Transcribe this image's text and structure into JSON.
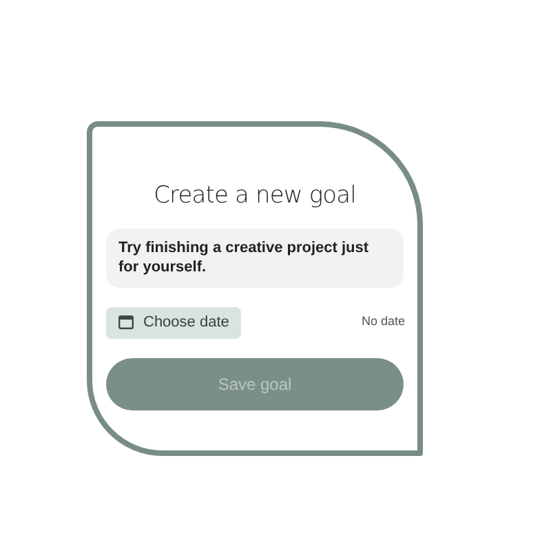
{
  "dialog": {
    "title": "Create a new goal",
    "goal_field": {
      "value": "Try finishing a creative project just for yourself."
    },
    "date_button": {
      "label": "Choose date"
    },
    "date_value": "No date",
    "save_button": {
      "label": "Save goal",
      "disabled": true
    }
  }
}
